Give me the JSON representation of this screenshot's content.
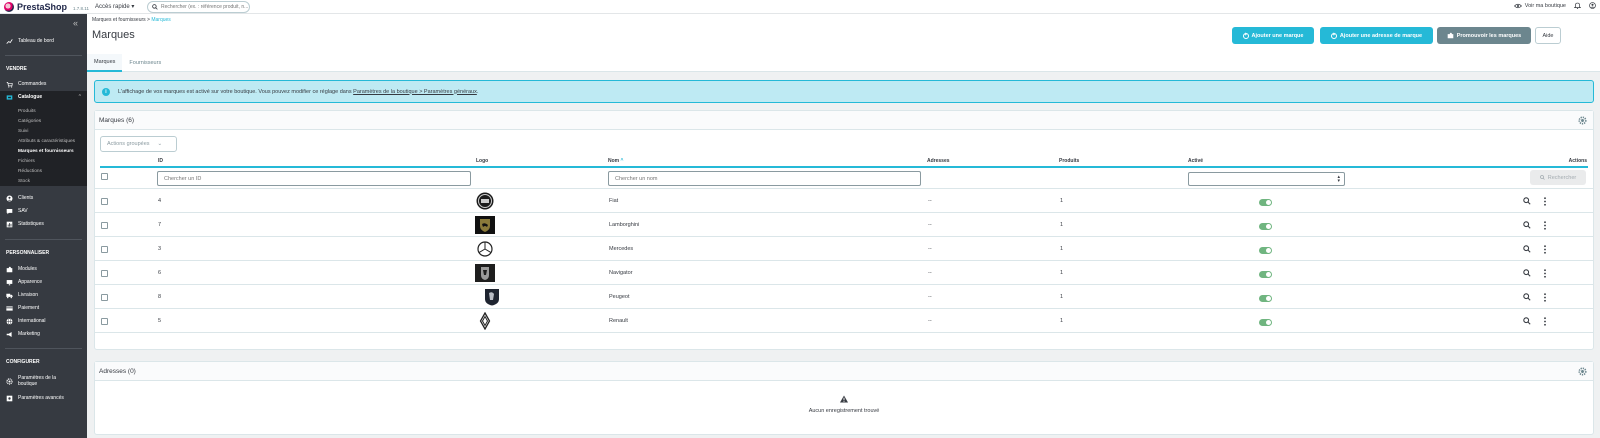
{
  "topbar": {
    "brand": "PrestaShop",
    "version": "1.7.8.11",
    "quick_access": "Accès rapide",
    "search_placeholder": "Rechercher (ex. : référence produit, n...",
    "view_shop": "Voir ma boutique"
  },
  "sidebar": {
    "dashboard": "Tableau de bord",
    "section_sell": "VENDRE",
    "orders": "Commandes",
    "catalog": "Catalogue",
    "catalog_items": [
      "Produits",
      "Catégories",
      "Suivi",
      "Attributs & caractéristiques",
      "Marques et fournisseurs",
      "Fichiers",
      "Réductions",
      "Stock"
    ],
    "customers": "Clients",
    "sav": "SAV",
    "stats": "Statistiques",
    "section_custom": "PERSONNALISER",
    "modules": "Modules",
    "appearance": "Apparence",
    "shipping": "Livraison",
    "payment": "Paiement",
    "international": "International",
    "marketing": "Marketing",
    "section_config": "CONFIGURER",
    "shop_params": "Paramètres de la boutique",
    "advanced_params": "Paramètres avancés"
  },
  "header": {
    "breadcrumb_parent": "Marques et fournisseurs",
    "breadcrumb_sep": ">",
    "breadcrumb_current": "Marques",
    "title": "Marques",
    "btn_add_brand": "Ajouter une marque",
    "btn_add_address": "Ajouter une adresse de marque",
    "btn_promote": "Promouvoir les marques",
    "btn_help": "Aide",
    "tabs": [
      "Marques",
      "Fournisseurs"
    ]
  },
  "alert": {
    "text": "L'affichage de vos marques est activé sur votre boutique. Vous pouvez modifier ce réglage dans",
    "link": "Paramètres de la boutique > Paramètres généraux",
    "end": "."
  },
  "brands_panel": {
    "title": "Marques (6)",
    "bulk_actions": "Actions groupées",
    "columns": {
      "id": "ID",
      "logo": "Logo",
      "name": "Nom",
      "addresses": "Adresses",
      "products": "Produits",
      "active": "Activé",
      "actions": "Actions"
    },
    "filter_id_placeholder": "Chercher un ID",
    "filter_name_placeholder": "Chercher un nom",
    "search_button": "Rechercher",
    "rows": [
      {
        "id": "4",
        "name": "Fiat",
        "addresses": "--",
        "products": "1",
        "active": true
      },
      {
        "id": "7",
        "name": "Lamborghini",
        "addresses": "--",
        "products": "1",
        "active": true
      },
      {
        "id": "3",
        "name": "Mercedes",
        "addresses": "--",
        "products": "1",
        "active": true
      },
      {
        "id": "6",
        "name": "Navigator",
        "addresses": "--",
        "products": "1",
        "active": true
      },
      {
        "id": "8",
        "name": "Peugeot",
        "addresses": "--",
        "products": "1",
        "active": true
      },
      {
        "id": "5",
        "name": "Renault",
        "addresses": "--",
        "products": "1",
        "active": true
      }
    ]
  },
  "addresses_panel": {
    "title": "Adresses (0)",
    "empty": "Aucun enregistrement trouvé"
  },
  "colors": {
    "accent": "#25b9d7",
    "sidebar": "#363a41",
    "toggle_on": "#70b580"
  }
}
